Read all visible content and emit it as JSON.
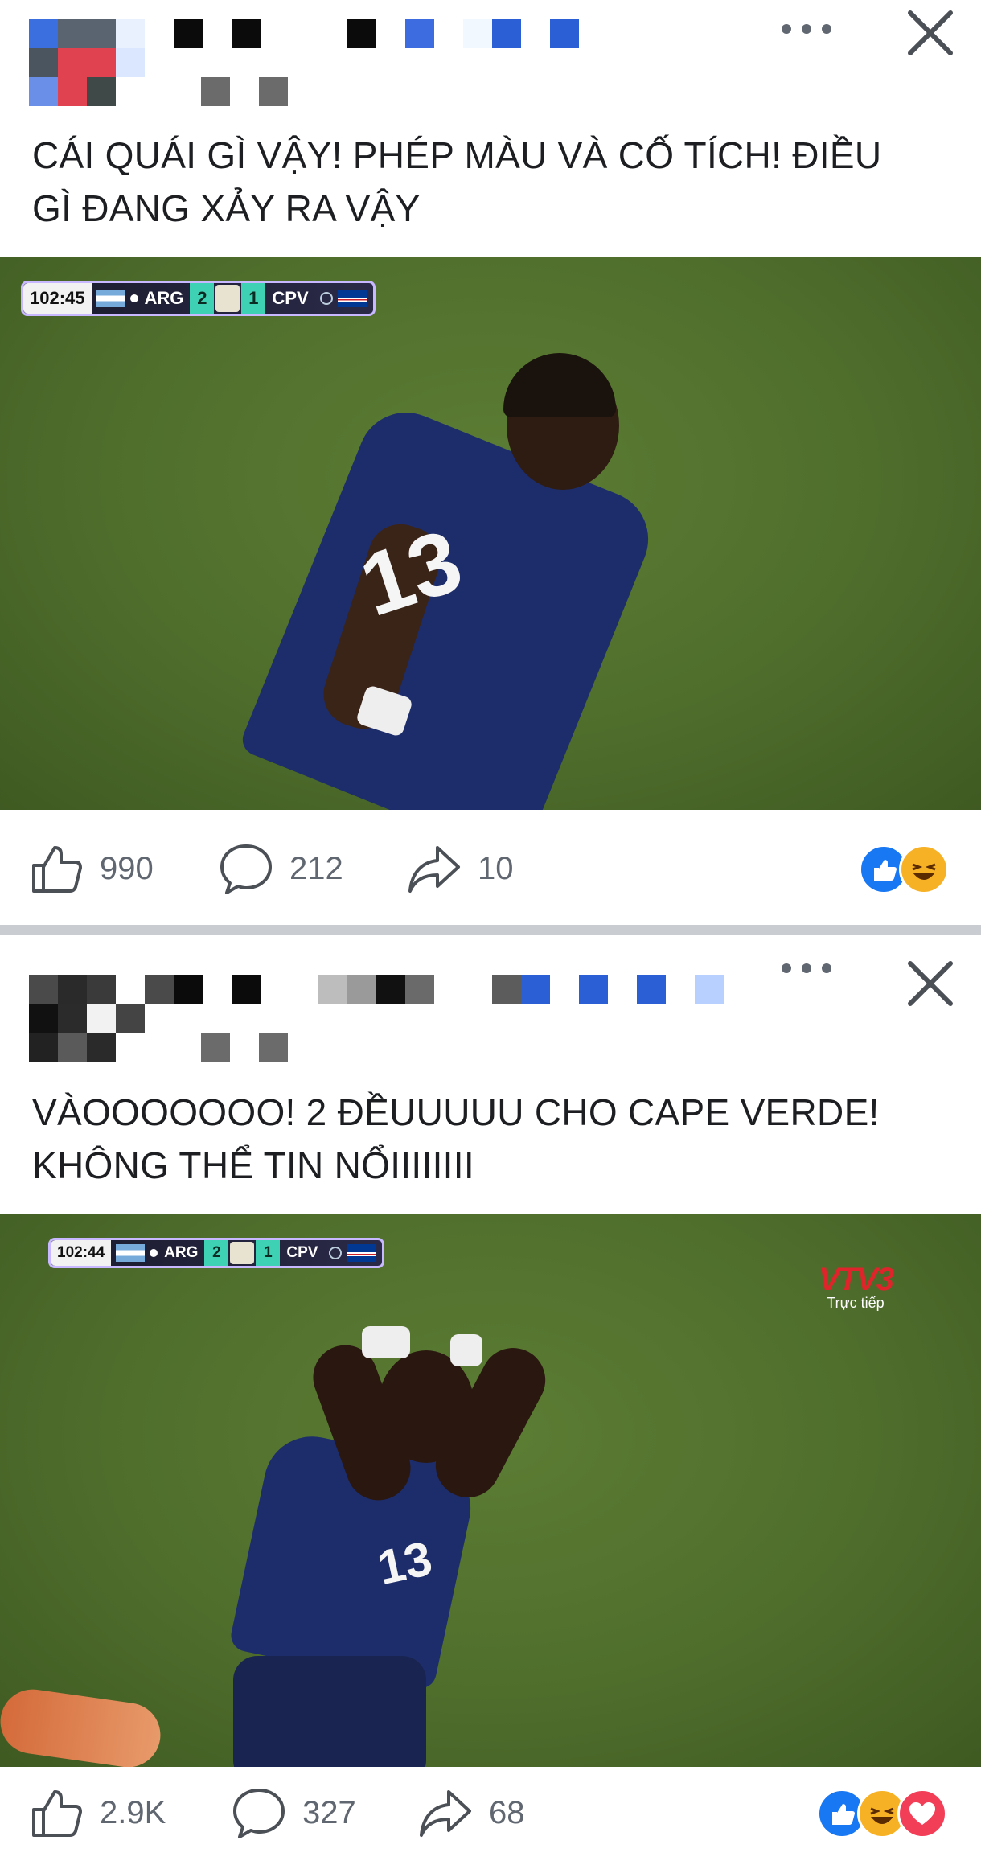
{
  "posts": [
    {
      "caption_lines": [
        "CÁI QUÁI GÌ VẬY! PHÉP MÀU VÀ CỐ TÍCH! ĐIỀU",
        "GÌ ĐANG XẢY RA VẬY"
      ],
      "scorebug": {
        "time": "102:45",
        "home": "ARG",
        "home_score": "2",
        "away_score": "1",
        "away": "CPV"
      },
      "stats": {
        "likes": "990",
        "comments": "212",
        "shares": "10"
      },
      "reactions": [
        "like",
        "haha"
      ]
    },
    {
      "caption_lines": [
        "VÀOOOOOOO! 2 ĐỀUUUUU CHO CAPE VERDE!",
        "KHÔNG THỂ TIN NỔIIIIIIII"
      ],
      "scorebug": {
        "time": "102:44",
        "home": "ARG",
        "home_score": "2",
        "away_score": "1",
        "away": "CPV"
      },
      "broadcaster": {
        "logo": "VTV3",
        "live_label": "Trực tiếp"
      },
      "stats": {
        "likes": "2.9K",
        "comments": "327",
        "shares": "68"
      },
      "reactions": [
        "like",
        "haha",
        "love"
      ]
    }
  ],
  "icons": {
    "more": "more-horizontal-icon",
    "close": "close-icon",
    "like": "thumbs-up-icon",
    "comment": "comment-bubble-icon",
    "share": "share-arrow-icon"
  },
  "colors": {
    "text": "#1c1e21",
    "muted": "#606770",
    "like_blue": "#1877f2",
    "haha_yellow": "#f7b125",
    "love_red": "#f33e58",
    "divider": "#c9ccd1"
  }
}
